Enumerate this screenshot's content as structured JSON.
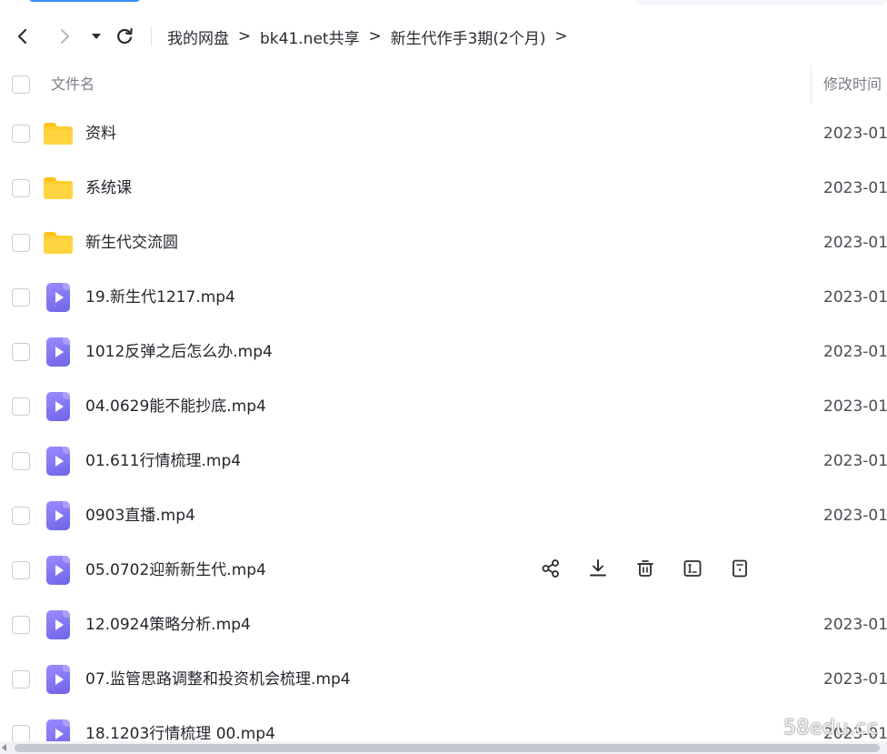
{
  "breadcrumbs": [
    "我的网盘",
    "bk41.net共享",
    "新生代作手3期(2个月)"
  ],
  "breadcrumb_separator": ">",
  "header": {
    "name_label": "文件名",
    "time_label": "修改时间"
  },
  "rows": [
    {
      "type": "folder",
      "name": "资料",
      "time": "2023-01"
    },
    {
      "type": "folder",
      "name": "系统课",
      "time": "2023-01"
    },
    {
      "type": "folder",
      "name": "新生代交流圆",
      "time": "2023-01"
    },
    {
      "type": "video",
      "name": "19.新生代1217.mp4",
      "time": "2023-01"
    },
    {
      "type": "video",
      "name": "1012反弹之后怎么办.mp4",
      "time": "2023-01"
    },
    {
      "type": "video",
      "name": "04.0629能不能抄底.mp4",
      "time": "2023-01"
    },
    {
      "type": "video",
      "name": "01.611行情梳理.mp4",
      "time": "2023-01"
    },
    {
      "type": "video",
      "name": "0903直播.mp4",
      "time": "2023-01"
    },
    {
      "type": "video",
      "name": "05.0702迎新新生代.mp4",
      "time": "",
      "hover": true
    },
    {
      "type": "video",
      "name": "12.0924策略分析.mp4",
      "time": "2023-01"
    },
    {
      "type": "video",
      "name": "07.监管思路调整和投资机会梳理.mp4",
      "time": "2023-01"
    },
    {
      "type": "video",
      "name": "18.1203行情梳理 00.mp4",
      "time": "2023-01"
    }
  ],
  "row_actions": [
    "share-icon",
    "download-icon",
    "delete-icon",
    "rename-icon",
    "more-info-icon"
  ],
  "watermark": "58edu.cc",
  "colors": {
    "folder": "#ffcc2e",
    "video": "#7b6ff0",
    "accent": "#3a8cff"
  }
}
